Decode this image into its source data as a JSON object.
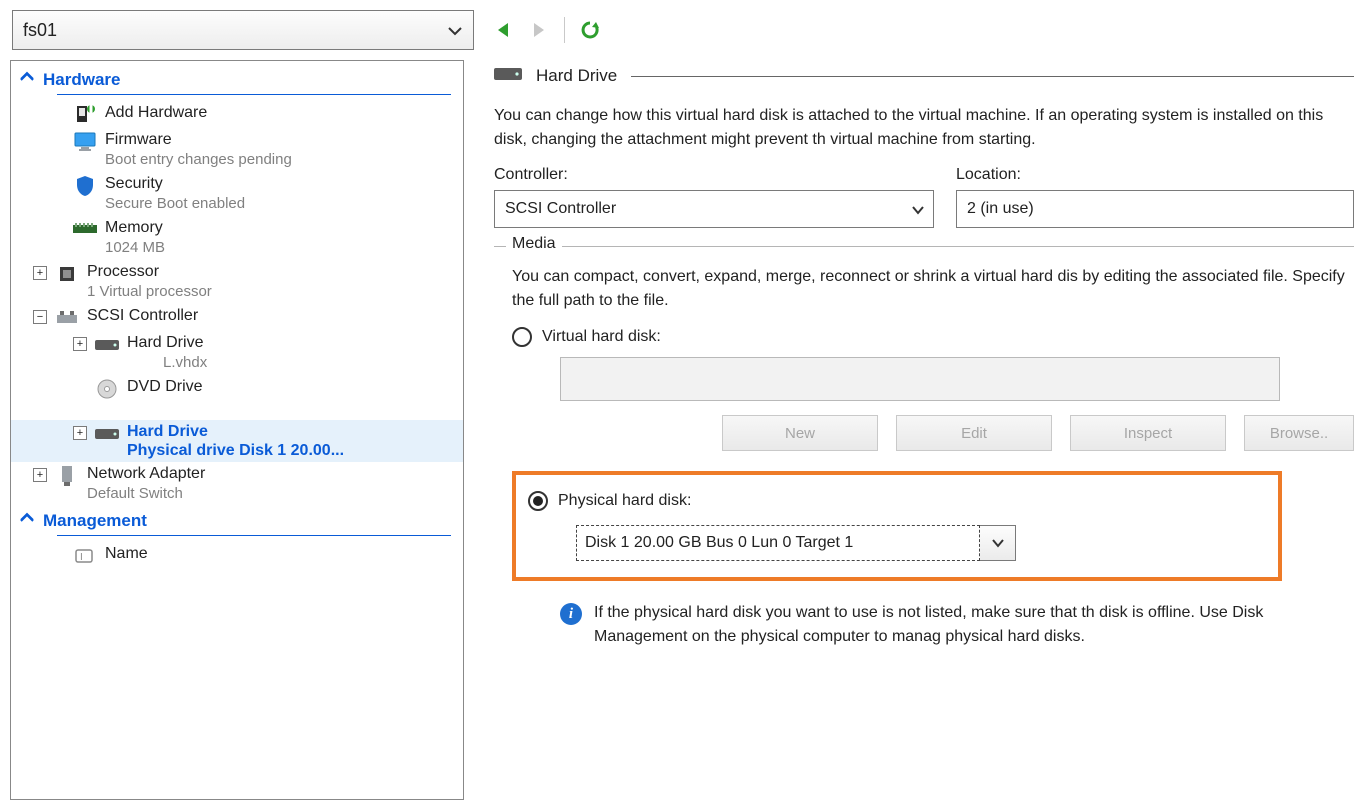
{
  "vm_selector": {
    "value": "fs01"
  },
  "sections": {
    "hardware": "Hardware",
    "management": "Management"
  },
  "tree": {
    "add_hardware": "Add Hardware",
    "firmware": {
      "label": "Firmware",
      "sub": "Boot entry changes pending"
    },
    "security": {
      "label": "Security",
      "sub": "Secure Boot enabled"
    },
    "memory": {
      "label": "Memory",
      "sub": "1024 MB"
    },
    "processor": {
      "label": "Processor",
      "sub": "1 Virtual processor"
    },
    "scsi": {
      "label": "SCSI Controller"
    },
    "hdd1": {
      "label": "Hard Drive",
      "sub": "L.vhdx"
    },
    "dvd": {
      "label": "DVD Drive"
    },
    "hdd2": {
      "label": "Hard Drive",
      "sub": "Physical drive Disk 1 20.00..."
    },
    "net": {
      "label": "Network Adapter",
      "sub": "Default Switch"
    },
    "name": {
      "label": "Name"
    }
  },
  "detail": {
    "title": "Hard Drive",
    "intro": "You can change how this virtual hard disk is attached to the virtual machine. If an operating system is installed on this disk, changing the attachment might prevent th virtual machine from starting.",
    "controller_label": "Controller:",
    "controller_value": "SCSI Controller",
    "location_label": "Location:",
    "location_value": "2 (in use)",
    "media_caption": "Media",
    "media_intro": "You can compact, convert, expand, merge, reconnect or shrink a virtual hard dis by editing the associated file. Specify the full path to the file.",
    "radio_vhd": "Virtual hard disk:",
    "btn_new": "New",
    "btn_edit": "Edit",
    "btn_inspect": "Inspect",
    "btn_browse": "Browse..",
    "radio_phys": "Physical hard disk:",
    "phys_value": "Disk 1 20.00 GB Bus 0 Lun 0 Target 1",
    "info_text": "If the physical hard disk you want to use is not listed, make sure that th disk is offline. Use Disk Management on the physical computer to manag physical hard disks."
  }
}
